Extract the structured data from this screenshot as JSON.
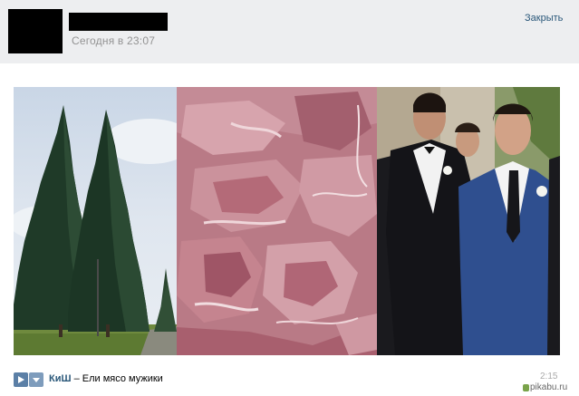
{
  "post": {
    "time": "Сегодня в 23:07",
    "close_label": "Закрыть"
  },
  "photos": [
    {
      "subject": "spruce-trees"
    },
    {
      "subject": "raw-meat"
    },
    {
      "subject": "men-in-suits"
    }
  ],
  "audio": {
    "artist": "КиШ",
    "separator": " – ",
    "title": "Ели мясо мужики",
    "duration": "2:15"
  },
  "watermark": {
    "text": "pikabu.ru"
  },
  "colors": {
    "header_bg": "#edeef0",
    "link": "#2b587a",
    "muted": "#939393"
  }
}
